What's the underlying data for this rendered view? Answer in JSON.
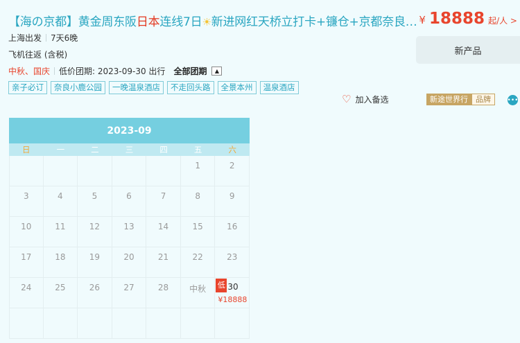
{
  "product": {
    "title_prefix": "【海の京都】黄金周东阪",
    "title_highlight": "日本",
    "title_mid": "连线7日",
    "title_icon": "sun-icon",
    "title_suffix": "新进网红天桥立打卡+镰仓+京都奈良富士山…",
    "departure": "上海出发",
    "duration": "7天6晚",
    "transport": "飞机往返 (含税)",
    "festival": "中秋、国庆",
    "low_price_date": "低价团期: 2023-09-30 出行",
    "all_dates_label": "全部团期",
    "collapse_icon": "triangle-up-icon"
  },
  "price": {
    "currency": "¥",
    "amount": "18888",
    "suffix": "起/人 >"
  },
  "new_product_label": "新产品",
  "tags": [
    "亲子必订",
    "奈良小鹿公园",
    "一晚温泉酒店",
    "不走回头路",
    "全景本州",
    "温泉酒店"
  ],
  "favorite": {
    "icon": "heart-icon",
    "label": "加入备选"
  },
  "brand": {
    "name": "新途世界行",
    "tag": "品牌",
    "chat_icon": "chat-icon"
  },
  "calendar": {
    "month": "2023-09",
    "weekdays": [
      "日",
      "一",
      "二",
      "三",
      "四",
      "五",
      "六"
    ],
    "weeks": [
      [
        "",
        "",
        "",
        "",
        "",
        "1",
        "2"
      ],
      [
        "3",
        "4",
        "5",
        "6",
        "7",
        "8",
        "9"
      ],
      [
        "10",
        "11",
        "12",
        "13",
        "14",
        "15",
        "16"
      ],
      [
        "17",
        "18",
        "19",
        "20",
        "21",
        "22",
        "23"
      ],
      [
        "24",
        "25",
        "26",
        "27",
        "28",
        "中秋",
        "30"
      ],
      [
        "",
        "",
        "",
        "",
        "",
        "",
        ""
      ]
    ],
    "low_marker": "低",
    "low_day": "30",
    "low_price": "¥18888"
  },
  "colors": {
    "accent": "#2aa6c1",
    "price": "#e8452d",
    "calendar_header": "#75cfe0",
    "brand": "#c7a563"
  }
}
